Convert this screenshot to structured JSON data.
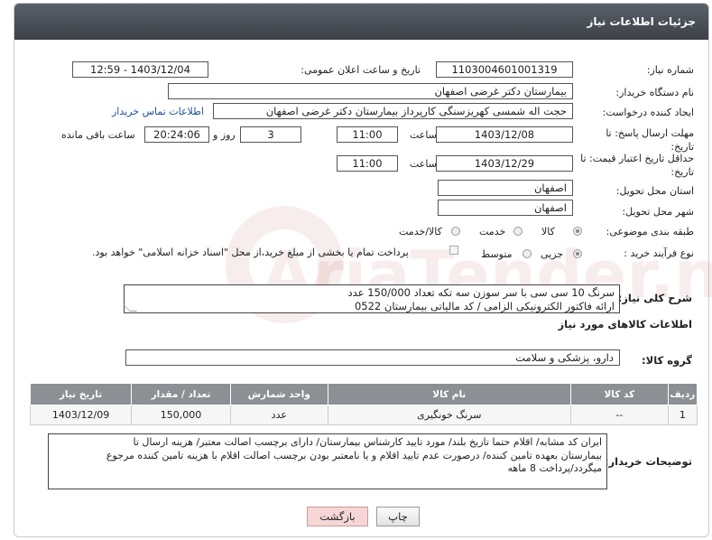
{
  "header": {
    "title": "جزئیات اطلاعات نیاز"
  },
  "fields": {
    "need_number_label": "شماره نیاز:",
    "need_number": "1103004601001319",
    "announce_label": "تاریخ و ساعت اعلان عمومی:",
    "announce_value": "1403/12/04 - 12:59",
    "buyer_label": "نام دستگاه خریدار:",
    "buyer": "بیمارستان دکتر غرضی اصفهان",
    "creator_label": "ایجاد کننده درخواست:",
    "creator": "حجت اله شمسی کهریزسنگی کارپرداز بیمارستان دکتر غرضی اصفهان",
    "contact_link": "اطلاعات تماس خریدار",
    "deadline_label": "مهلت ارسال پاسخ: تا تاریخ:",
    "deadline_date": "1403/12/08",
    "time_label": "ساعت",
    "deadline_time": "11:00",
    "days": "3",
    "days_label": "روز و",
    "remaining_time": "20:24:06",
    "remaining_label": "ساعت باقی مانده",
    "min_validity_label": "حداقل تاریخ اعتبار قیمت: تا تاریخ:",
    "min_validity_date": "1403/12/29",
    "min_validity_time": "11:00",
    "province_label": "استان محل تحویل:",
    "province": "اصفهان",
    "city_label": "شهر محل تحویل:",
    "city": "اصفهان",
    "category_label": "طبقه بندی موضوعی:",
    "category_options": [
      "کالا",
      "خدمت",
      "کالا/خدمت"
    ],
    "purchase_type_label": "نوع فرآیند خرید :",
    "purchase_options": [
      "جزیی",
      "متوسط"
    ],
    "payment_note": "پرداخت تمام یا بخشی از مبلغ خرید،از محل \"اسناد خزانه اسلامی\" خواهد بود."
  },
  "summary": {
    "label": "شرح کلی نیاز:",
    "text_line1": "سرنگ 10 سی سی با سر سوزن سه تکه تعداد 150/000 عدد",
    "text_line2": "ارائه فاکتور الکترونیکی الزامی / کد مالیاتی بیمارستان 0522"
  },
  "goods": {
    "section_title": "اطلاعات کالاهای مورد نیاز",
    "group_label": "گروه کالا:",
    "group_value": "دارو، پزشکی و سلامت",
    "columns": [
      "ردیف",
      "کد کالا",
      "نام کالا",
      "واحد شمارش",
      "تعداد / مقدار",
      "تاریخ نیاز"
    ],
    "rows": [
      [
        "1",
        "--",
        "سرنگ خونگیری",
        "عدد",
        "150,000",
        "1403/12/09"
      ]
    ]
  },
  "buyer_notes": {
    "label": "توضیحات خریدار:",
    "line1": "ایران کد مشابه/ اقلام حتما تاریخ بلند/ مورد تایید کارشناس بیمارستان/ دارای برچسب اصالت معتبر/ هزینه ارسال تا",
    "line2": "بیمارستان بعهده تامین کننده/ درصورت عدم تایید اقلام و یا نامعتبر بودن برچسب اصالت اقلام با هزینه تامین کننده مرجوع",
    "line3": "میگردد/پرداخت 8 ماهه"
  },
  "buttons": {
    "print": "چاپ",
    "back": "بازگشت"
  },
  "watermark": "AriaTender.neT",
  "colors": {
    "header_bg": "#4a4f56",
    "table_header": "#8c8f93",
    "back_button_bg": "#f6d6d6"
  }
}
